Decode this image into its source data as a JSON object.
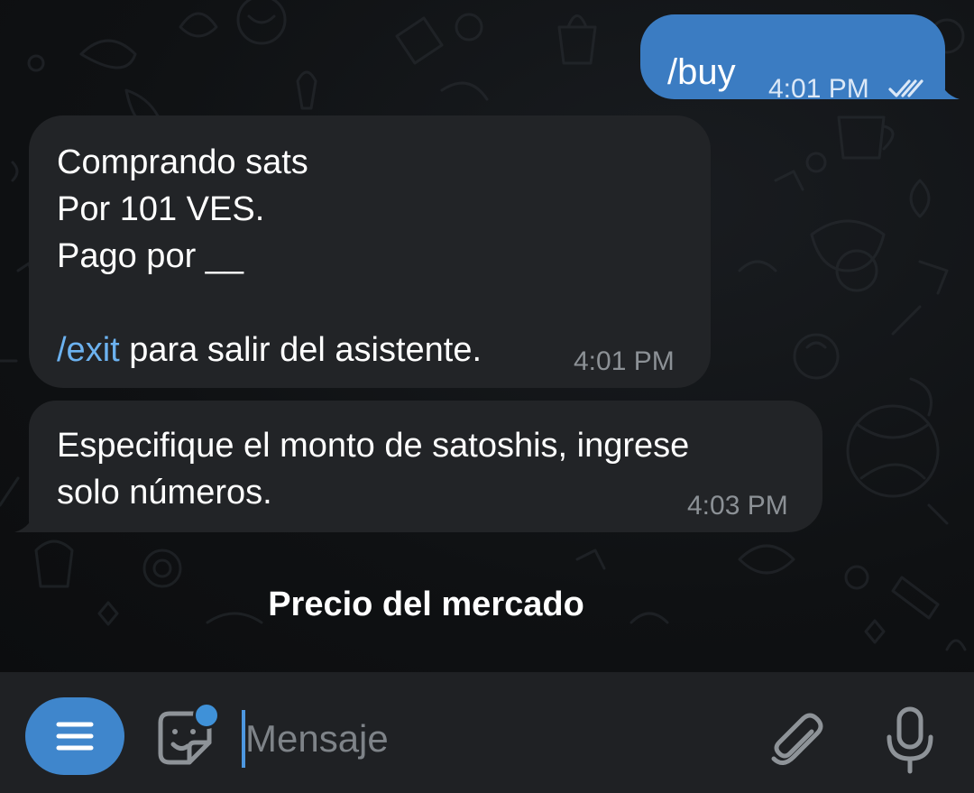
{
  "messages": {
    "outgoing": {
      "text": "/buy",
      "time": "4:01 PM",
      "status_icon": "double-check-icon"
    },
    "incoming_1": {
      "line1": "Comprando sats",
      "line2": "Por 101 VES.",
      "line3": "Pago por __",
      "command": "/exit",
      "command_suffix": " para salir del asistente.",
      "time": "4:01 PM"
    },
    "incoming_2": {
      "line1": "Especifique el monto de satoshis, ingrese",
      "line2": "solo números.",
      "time": "4:03 PM"
    }
  },
  "keyboard": {
    "button_label": "Precio del mercado"
  },
  "input_bar": {
    "placeholder": "Mensaje",
    "menu_icon": "menu-icon",
    "sticker_icon": "sticker-icon",
    "attach_icon": "paperclip-icon",
    "mic_icon": "microphone-icon"
  },
  "colors": {
    "outgoing_bubble": "#3b7cc2",
    "incoming_bubble": "#222427",
    "link": "#6cb2f0",
    "accent": "#3f86cc",
    "input_bar": "#1f2124"
  }
}
